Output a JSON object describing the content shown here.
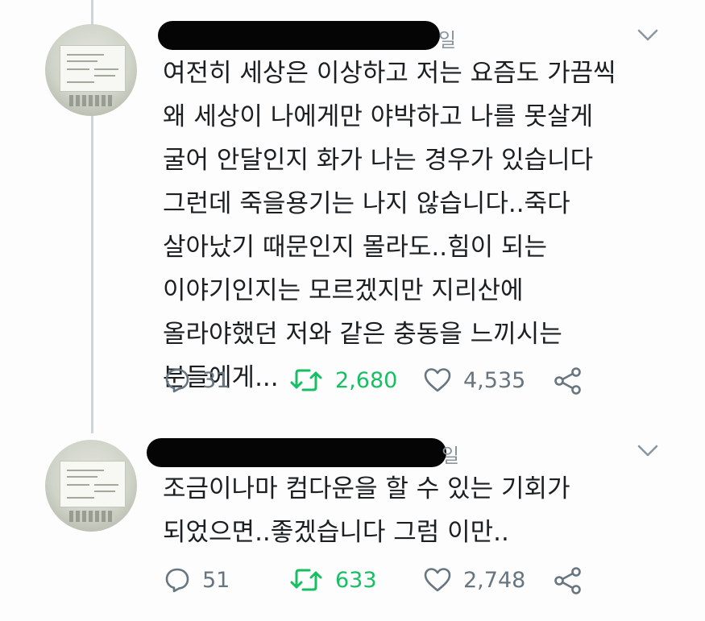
{
  "colors": {
    "retweet": "#17bf63",
    "icon_gray": "#66757f",
    "text": "#1b1f22",
    "thread_line": "#cdd6dd"
  },
  "tweets": [
    {
      "meta_tail": "일",
      "text_lines": [
        "여전히 세상은 이상하고 저는 요즘도 가끔씩",
        "왜 세상이 나에게만 야박하고 나를 못살게",
        "굴어 안달인지 화가 나는 경우가 있습니다",
        "그런데 죽을용기는 나지 않습니다..죽다",
        "살아났기 때문인지 몰라도..힘이 되는",
        "이야기인지는 모르겠지만 지리산에",
        "올라야했던 저와 같은 충동을 느끼시는",
        "분들에게..."
      ],
      "replies": "31",
      "retweets": "2,680",
      "likes": "4,535",
      "icons": {
        "reply": "reply-icon",
        "retweet": "retweet-icon",
        "like": "heart-icon",
        "share": "share-icon",
        "more": "chevron-down-icon"
      }
    },
    {
      "meta_tail": "일",
      "text_lines": [
        "조금이나마 컴다운을 할 수 있는 기회가",
        "되었으면..좋겠습니다 그럼 이만.."
      ],
      "replies": "51",
      "retweets": "633",
      "likes": "2,748",
      "icons": {
        "reply": "reply-icon",
        "retweet": "retweet-icon",
        "like": "heart-icon",
        "share": "share-icon",
        "more": "chevron-down-icon"
      }
    }
  ]
}
